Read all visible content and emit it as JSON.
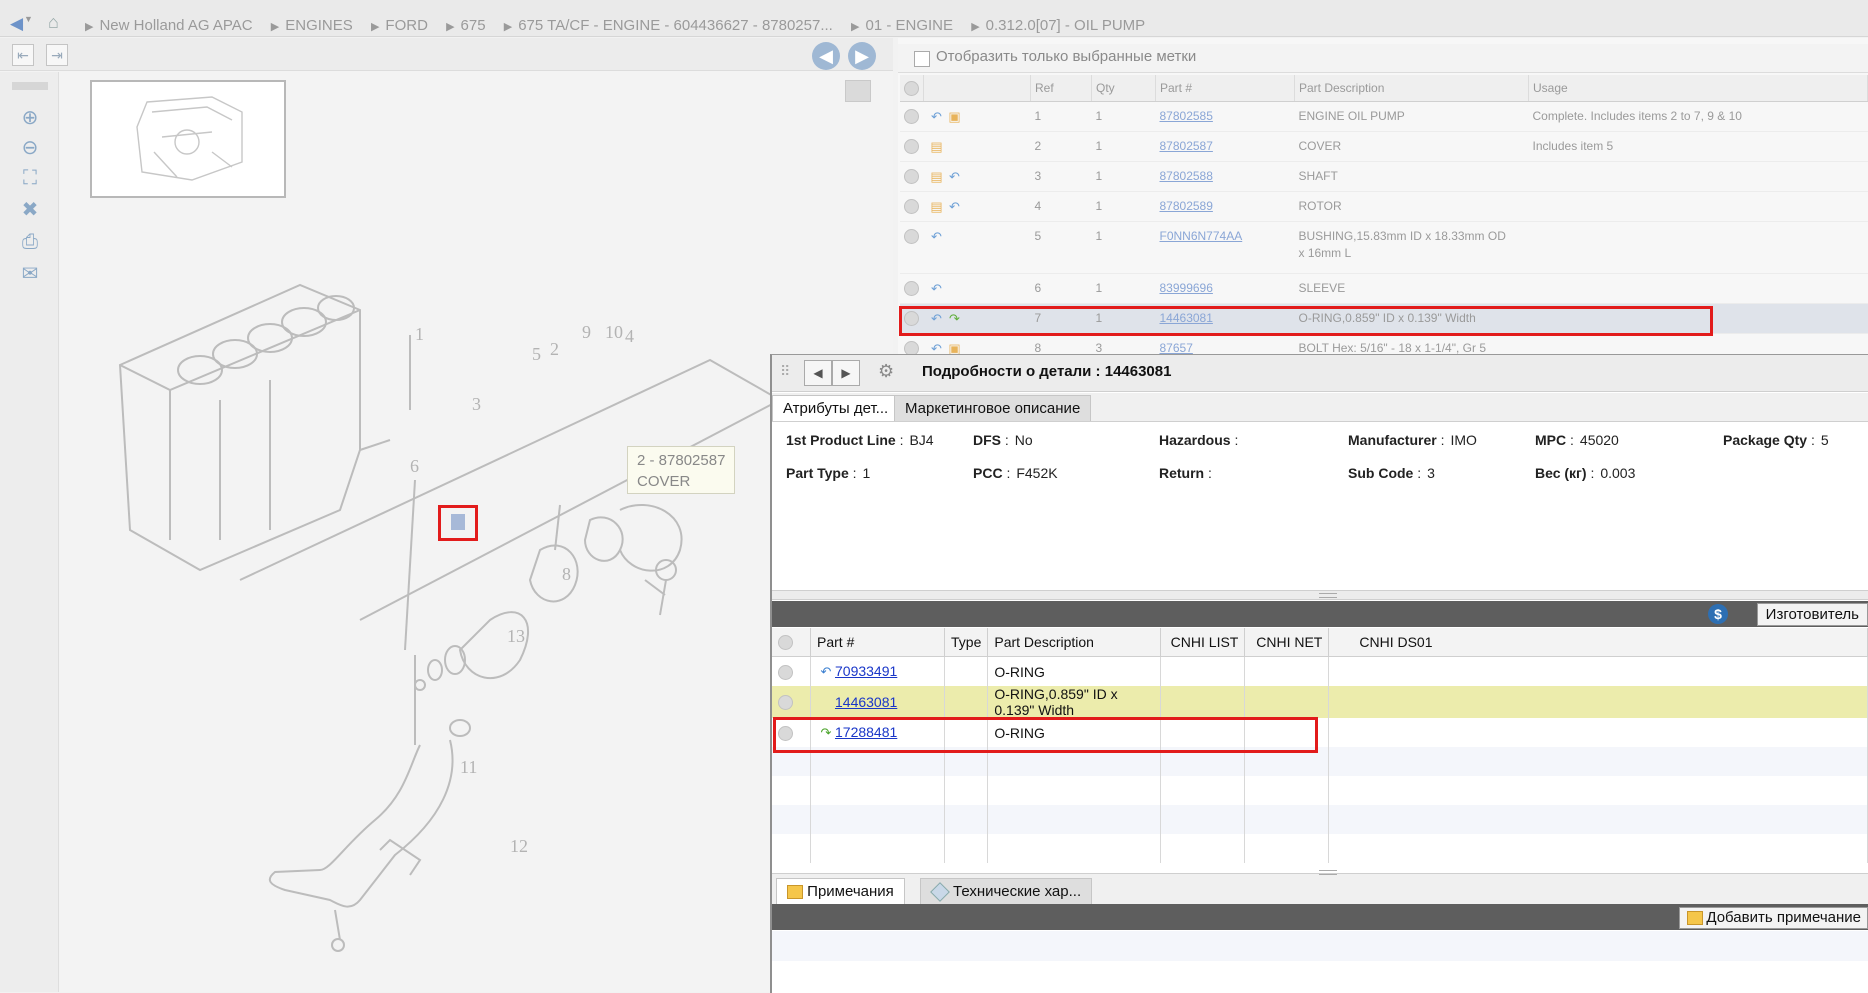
{
  "breadcrumb": {
    "items": [
      "New Holland AG APAC",
      "ENGINES",
      "FORD",
      "675",
      "675 TA/CF - ENGINE - 604436627 - 8780257...",
      "01 - ENGINE",
      "0.312.0[07] - OIL PUMP"
    ]
  },
  "drawing": {
    "tooltip_ref": "2 -  87802587",
    "tooltip_desc": "COVER",
    "callouts": [
      "1",
      "2",
      "4",
      "5",
      "9",
      "10",
      "3",
      "8",
      "6",
      "13",
      "11",
      "12"
    ]
  },
  "parts_filter": {
    "label": "Отобразить только выбранные метки"
  },
  "parts_table": {
    "headers": [
      "Ref",
      "Qty",
      "Part #",
      "Part Description",
      "Usage"
    ],
    "rows": [
      {
        "ref": "1",
        "qty": "1",
        "part": "87802585",
        "desc": "ENGINE OIL PUMP",
        "usage": "Complete. Includes items 2 to 7, 9 & 10"
      },
      {
        "ref": "2",
        "qty": "1",
        "part": "87802587",
        "desc": "COVER",
        "usage": "Includes item 5"
      },
      {
        "ref": "3",
        "qty": "1",
        "part": "87802588",
        "desc": "SHAFT",
        "usage": ""
      },
      {
        "ref": "4",
        "qty": "1",
        "part": "87802589",
        "desc": "ROTOR",
        "usage": ""
      },
      {
        "ref": "5",
        "qty": "1",
        "part": "F0NN6N774AA",
        "desc": "BUSHING,15.83mm ID x 18.33mm OD",
        "desc2": "x 16mm L",
        "usage": ""
      },
      {
        "ref": "6",
        "qty": "1",
        "part": "83999696",
        "desc": "SLEEVE",
        "usage": ""
      },
      {
        "ref": "7",
        "qty": "1",
        "part": "14463081",
        "desc": "O-RING,0.859\" ID x 0.139\" Width",
        "usage": ""
      },
      {
        "ref": "8",
        "qty": "3",
        "part": "87657",
        "desc": "BOLT Hex: 5/16\" - 18 x 1-1/4\", Gr 5",
        "usage": ""
      }
    ]
  },
  "details": {
    "title": "Подробности о детали : 14463081",
    "tabs": [
      "Атрибуты дет...",
      "Маркетинговое описание"
    ],
    "attrs": [
      {
        "label": "1st Product Line",
        "value": "BJ4"
      },
      {
        "label": "DFS",
        "value": "No"
      },
      {
        "label": "Hazardous",
        "value": ""
      },
      {
        "label": "Manufacturer",
        "value": "IMO"
      },
      {
        "label": "MPC",
        "value": "45020"
      },
      {
        "label": "Package Qty",
        "value": "5"
      },
      {
        "label": "Part Type",
        "value": "1"
      },
      {
        "label": "PCC",
        "value": "F452K"
      },
      {
        "label": "Return",
        "value": ""
      },
      {
        "label": "Sub Code",
        "value": "3"
      },
      {
        "label": "Вес (кг)",
        "value": "0.003"
      }
    ],
    "manufacturer_button": "Изготовитель",
    "manufacturer_icon": "$",
    "sub_headers": [
      "Part #",
      "Type",
      "Part Description",
      "CNHI LIST",
      "CNHI NET",
      "CNHI DS01"
    ],
    "sub_rows": [
      {
        "part": "70933491",
        "type": "",
        "desc": "O-RING",
        "list": "",
        "net": "",
        "ds01": ""
      },
      {
        "part": "14463081",
        "type": "",
        "desc": "O-RING,0.859\" ID x 0.139\" Width",
        "list": "",
        "net": "",
        "ds01": ""
      },
      {
        "part": "17288481",
        "type": "",
        "desc": "O-RING",
        "list": "",
        "net": "",
        "ds01": ""
      }
    ],
    "bottom_tabs": [
      "Примечания",
      "Технические хар..."
    ],
    "add_note": "Добавить примечание"
  },
  "colors": {
    "highlight": "#e21b1b",
    "link": "#1936c8",
    "selected_row": "#ececac"
  }
}
